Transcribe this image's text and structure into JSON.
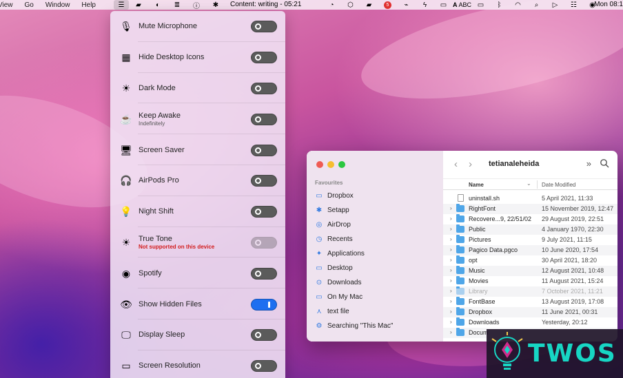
{
  "menubar": {
    "app_menus": [
      "View",
      "Go",
      "Window",
      "Help"
    ],
    "status_text": "Content: writing - 05:21",
    "notification_count": "5",
    "input_source": "ABC",
    "clock": "Mon 08:1"
  },
  "panel": {
    "items": [
      {
        "label": "Mute Microphone",
        "sub": "",
        "icon": "microphone-icon",
        "glyph": "🎙",
        "state": "off"
      },
      {
        "label": "Hide Desktop Icons",
        "sub": "",
        "icon": "grid-icon",
        "glyph": "▦",
        "state": "off"
      },
      {
        "label": "Dark Mode",
        "sub": "",
        "icon": "sun-icon",
        "glyph": "☀",
        "state": "off"
      },
      {
        "label": "Keep Awake",
        "sub": "Indefinitely",
        "icon": "cup-icon",
        "glyph": "☕",
        "state": "off"
      },
      {
        "label": "Screen Saver",
        "sub": "",
        "icon": "monitor-icon",
        "glyph": "🖥",
        "state": "off"
      },
      {
        "label": "AirPods Pro",
        "sub": "",
        "icon": "airpods-icon",
        "glyph": "🎧",
        "state": "off"
      },
      {
        "label": "Night Shift",
        "sub": "",
        "icon": "lamp-icon",
        "glyph": "💡",
        "state": "off"
      },
      {
        "label": "True Tone",
        "sub": "Not supported on this device",
        "icon": "sun-icon",
        "glyph": "☀",
        "state": "disabled"
      },
      {
        "label": "Spotify",
        "sub": "",
        "icon": "spotify-icon",
        "glyph": "◉",
        "state": "off"
      },
      {
        "label": "Show Hidden Files",
        "sub": "",
        "icon": "eye-icon",
        "glyph": "👁",
        "state": "on"
      },
      {
        "label": "Display Sleep",
        "sub": "",
        "icon": "display-icon",
        "glyph": "🖵",
        "state": "off"
      },
      {
        "label": "Screen Resolution",
        "sub": "",
        "icon": "resolution-icon",
        "glyph": "▭",
        "state": "off"
      }
    ]
  },
  "finder": {
    "sidebar_heading": "Favourites",
    "sidebar_items": [
      {
        "label": "Dropbox",
        "icon": "folder-icon",
        "glyph": "▭"
      },
      {
        "label": "Setapp",
        "icon": "setapp-icon",
        "glyph": "✱"
      },
      {
        "label": "AirDrop",
        "icon": "airdrop-icon",
        "glyph": "◎"
      },
      {
        "label": "Recents",
        "icon": "clock-icon",
        "glyph": "◷"
      },
      {
        "label": "Applications",
        "icon": "applications-icon",
        "glyph": "✦"
      },
      {
        "label": "Desktop",
        "icon": "desktop-icon",
        "glyph": "▭"
      },
      {
        "label": "Downloads",
        "icon": "downloads-icon",
        "glyph": "⊙"
      },
      {
        "label": "On My Mac",
        "icon": "folder-icon",
        "glyph": "▭"
      },
      {
        "label": "text file",
        "icon": "tag-icon",
        "glyph": "⋏"
      },
      {
        "label": "Searching \"This Mac\"",
        "icon": "gear-icon",
        "glyph": "⚙"
      }
    ],
    "title": "tetianaleheida",
    "columns": {
      "name": "Name",
      "date": "Date Modified"
    },
    "rows": [
      {
        "name": "uninstall.sh",
        "date": "5 April 2021, 11:33",
        "kind": "file"
      },
      {
        "name": "RightFont",
        "date": "15 November 2019, 12:47",
        "kind": "folder"
      },
      {
        "name": "Recovere...9, 22/51/02",
        "date": "29 August 2019, 22:51",
        "kind": "folder"
      },
      {
        "name": "Public",
        "date": "4 January 1970, 22:30",
        "kind": "folder"
      },
      {
        "name": "Pictures",
        "date": "9 July 2021, 11:15",
        "kind": "folder"
      },
      {
        "name": "Pagico Data.pgco",
        "date": "10 June 2020, 17:54",
        "kind": "folder"
      },
      {
        "name": "opt",
        "date": "30 April 2021, 18:20",
        "kind": "folder"
      },
      {
        "name": "Music",
        "date": "12 August 2021, 10:48",
        "kind": "folder"
      },
      {
        "name": "Movies",
        "date": "11 August 2021, 15:24",
        "kind": "folder"
      },
      {
        "name": "Library",
        "date": "7 October 2021, 11:21",
        "kind": "folder",
        "dim": true
      },
      {
        "name": "FontBase",
        "date": "13 August 2019, 17:08",
        "kind": "folder"
      },
      {
        "name": "Dropbox",
        "date": "11 June 2021, 00:31",
        "kind": "folder"
      },
      {
        "name": "Downloads",
        "date": "Yesterday, 20:12",
        "kind": "folder"
      },
      {
        "name": "Docum",
        "date": "",
        "kind": "folder"
      }
    ]
  },
  "watermark": {
    "text": "TWOS"
  },
  "colors": {
    "accent": "#1e6ff0",
    "toggle_off": "#5b5b5b",
    "warning": "#d21d1d",
    "watermark": "#17d6c4"
  }
}
